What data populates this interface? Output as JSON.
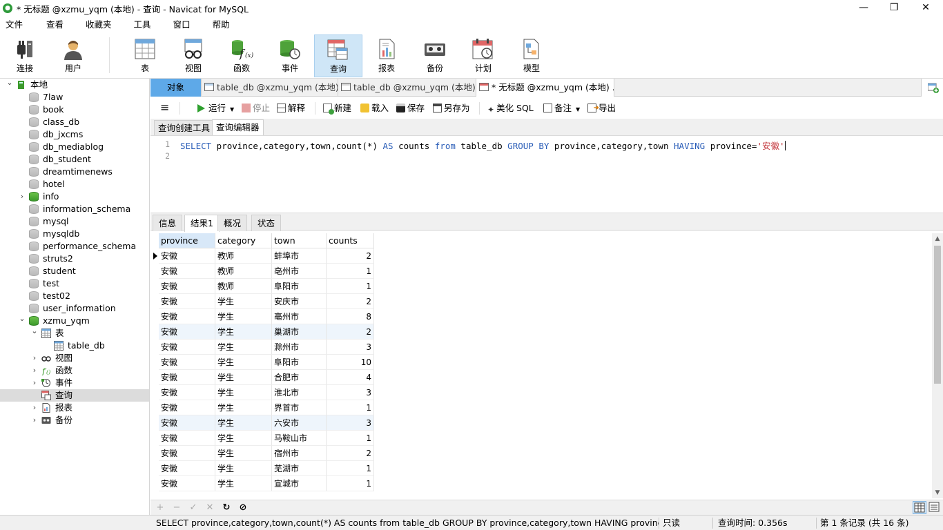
{
  "window": {
    "title": "* 无标题 @xzmu_yqm (本地) - 查询 - Navicat for MySQL",
    "minimize": "—",
    "restore": "❐",
    "close": "✕"
  },
  "menu": [
    "文件",
    "查看",
    "收藏夹",
    "工具",
    "窗口",
    "帮助"
  ],
  "toolbar": {
    "connect": "连接",
    "user": "用户",
    "table": "表",
    "view": "视图",
    "function": "函数",
    "event": "事件",
    "query": "查询",
    "report": "报表",
    "backup": "备份",
    "schedule": "计划",
    "model": "模型"
  },
  "tree": {
    "root": "本地",
    "dbs": [
      "7law",
      "book",
      "class_db",
      "db_jxcms",
      "db_mediablog",
      "db_student",
      "dreamtimenews",
      "hotel",
      "info",
      "information_schema",
      "mysql",
      "mysqldb",
      "performance_schema",
      "struts2",
      "student",
      "test",
      "test02",
      "user_information",
      "xzmu_yqm"
    ],
    "children": {
      "tables": "表",
      "table_db": "table_db",
      "views": "视图",
      "functions": "函数",
      "events": "事件",
      "queries": "查询",
      "reports": "报表",
      "backups": "备份"
    }
  },
  "tabs": {
    "objects": "对象",
    "tab1": "table_db @xzmu_yqm (本地)...",
    "tab2": "table_db @xzmu_yqm (本地)...",
    "tab3": "* 无标题 @xzmu_yqm (本地) ..."
  },
  "qtoolbar": {
    "run": "运行",
    "stop": "停止",
    "explain": "解释",
    "new": "新建",
    "load": "载入",
    "save": "保存",
    "save_as": "另存为",
    "beautify": "美化 SQL",
    "comment": "备注",
    "export": "导出"
  },
  "subtabs": {
    "builder": "查询创建工具",
    "editor": "查询编辑器"
  },
  "editor": {
    "line1": "1",
    "line2": "2",
    "k_select": "SELECT",
    "p1": " province,category,town,count(*) ",
    "k_as": "AS",
    "p2": " counts ",
    "k_from": "from",
    "p3": " table_db ",
    "k_group": "GROUP BY",
    "p4": " province,category,town ",
    "k_having": "HAVING",
    "p5": " province=",
    "s1": "'安徽'"
  },
  "result_tabs": {
    "info": "信息",
    "result": "结果1",
    "profile": "概况",
    "status": "状态"
  },
  "grid": {
    "columns": [
      "province",
      "category",
      "town",
      "counts"
    ],
    "rows": [
      [
        "安徽",
        "教师",
        "蚌埠市",
        "2"
      ],
      [
        "安徽",
        "教师",
        "亳州市",
        "1"
      ],
      [
        "安徽",
        "教师",
        "阜阳市",
        "1"
      ],
      [
        "安徽",
        "学生",
        "安庆市",
        "2"
      ],
      [
        "安徽",
        "学生",
        "亳州市",
        "8"
      ],
      [
        "安徽",
        "学生",
        "巢湖市",
        "2"
      ],
      [
        "安徽",
        "学生",
        "滁州市",
        "3"
      ],
      [
        "安徽",
        "学生",
        "阜阳市",
        "10"
      ],
      [
        "安徽",
        "学生",
        "合肥市",
        "4"
      ],
      [
        "安徽",
        "学生",
        "淮北市",
        "3"
      ],
      [
        "安徽",
        "学生",
        "界首市",
        "1"
      ],
      [
        "安徽",
        "学生",
        "六安市",
        "3"
      ],
      [
        "安徽",
        "学生",
        "马鞍山市",
        "1"
      ],
      [
        "安徽",
        "学生",
        "宿州市",
        "2"
      ],
      [
        "安徽",
        "学生",
        "芜湖市",
        "1"
      ],
      [
        "安徽",
        "学生",
        "宣城市",
        "1"
      ]
    ]
  },
  "gridnav": {
    "add": "+",
    "delete": "−",
    "apply": "✓",
    "discard": "✕",
    "refresh": "↻",
    "stop": "⊘"
  },
  "statusbar": {
    "sql": "SELECT province,category,town,count(*) AS counts from table_db GROUP BY province,category,town HAVING province='安徽'",
    "mode": "只读",
    "time": "查询时间: 0.356s",
    "records": "第 1 条记录 (共 16 条)"
  }
}
